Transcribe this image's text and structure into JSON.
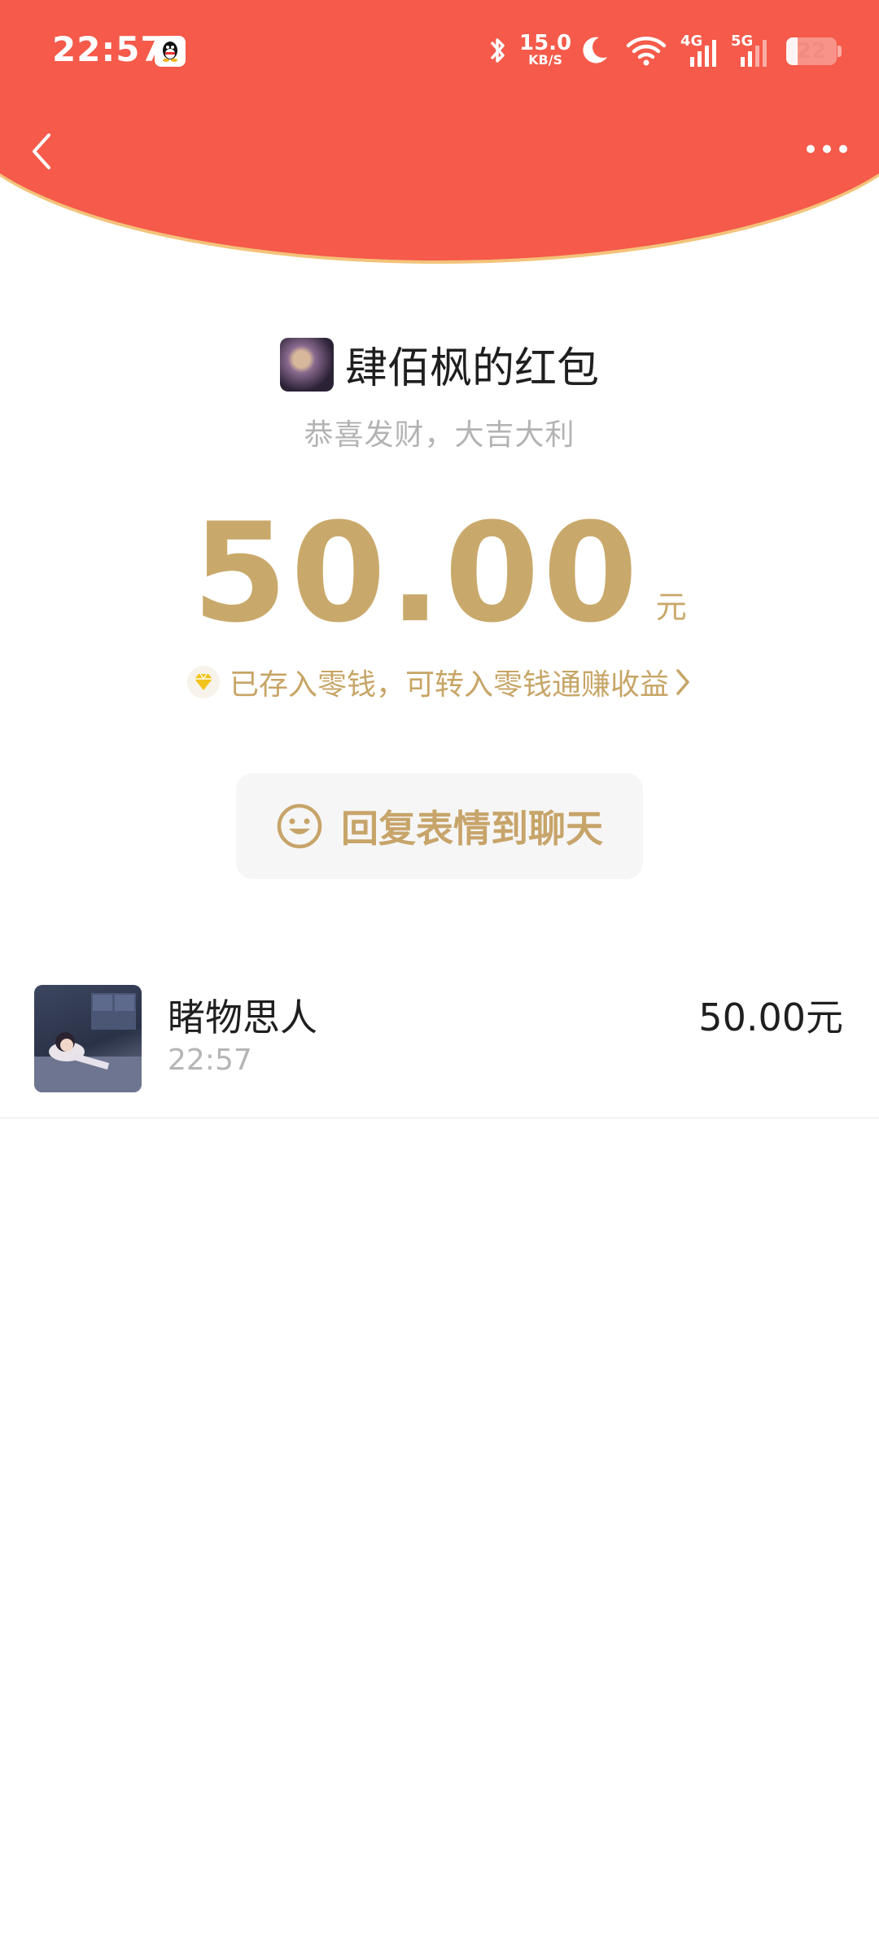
{
  "status_bar": {
    "time": "22:57",
    "net_speed": "15.0",
    "net_speed_unit": "KB/S",
    "net_a": "4G",
    "net_b": "5G",
    "battery": "22"
  },
  "red_packet": {
    "sender_title": "肆佰枫的红包",
    "blessing": "恭喜发财，大吉大利",
    "amount": "50.00",
    "amount_unit": "元",
    "saved_text": "已存入零钱，可转入零钱通赚收益",
    "reply_label": "回复表情到聊天"
  },
  "receivers": [
    {
      "name": "睹物思人",
      "time": "22:57",
      "amount": "50.00元"
    }
  ],
  "colors": {
    "header_red": "#f55a4a",
    "gold": "#c9a96b"
  }
}
